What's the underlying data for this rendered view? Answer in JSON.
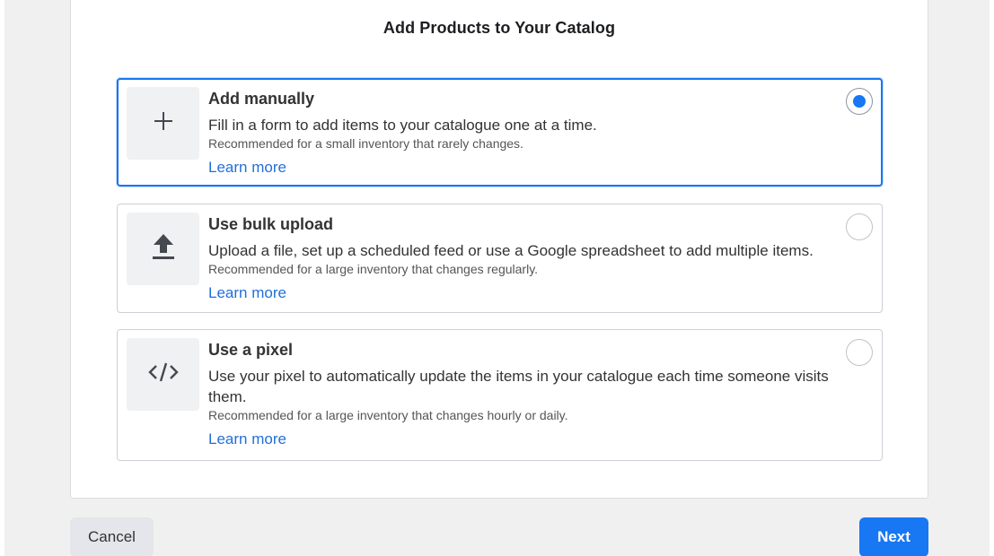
{
  "dialog": {
    "title": "Add Products to Your Catalog"
  },
  "options": [
    {
      "title": "Add manually",
      "description": "Fill in a form to add items to your catalogue one at a time.",
      "recommendation": "Recommended for a small inventory that rarely changes.",
      "link": "Learn more",
      "icon": "plus-icon",
      "selected": true
    },
    {
      "title": "Use bulk upload",
      "description": "Upload a file, set up a scheduled feed or use a Google spreadsheet to add multiple items.",
      "recommendation": "Recommended for a large inventory that changes regularly.",
      "link": "Learn more",
      "icon": "upload-icon",
      "selected": false
    },
    {
      "title": "Use a pixel",
      "description": "Use your pixel to automatically update the items in your catalogue each time someone visits them.",
      "recommendation": "Recommended for a large inventory that changes hourly or daily.",
      "link": "Learn more",
      "icon": "code-icon",
      "selected": false
    }
  ],
  "footer": {
    "cancel_label": "Cancel",
    "next_label": "Next"
  },
  "colors": {
    "accent": "#1877f2",
    "link": "#216fdb",
    "background": "#f0f0f0"
  }
}
